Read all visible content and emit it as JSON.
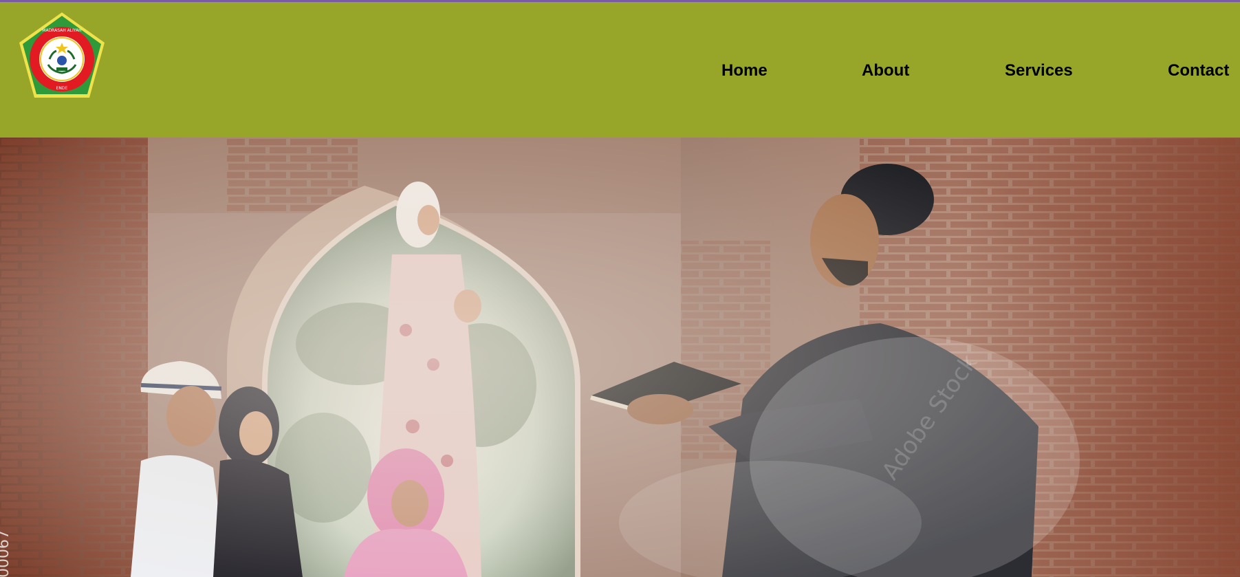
{
  "header": {
    "logo": {
      "name": "school-emblem",
      "ring_text": "MADRASAH ALIYAH KEJURUAN NEGERI",
      "bottom_text": "ENDE",
      "colors": {
        "outer": "#2f9a3a",
        "ring": "#e21b23",
        "inner": "#ffffff",
        "accent": "#f0c419"
      }
    },
    "background_color": "#97a629",
    "border_color": "#7a5aa6"
  },
  "nav": {
    "items": [
      {
        "label": "Home"
      },
      {
        "label": "About"
      },
      {
        "label": "Services"
      },
      {
        "label": "Contact"
      }
    ]
  },
  "hero": {
    "image": "photo-teacher-reading-to-children-in-ruin",
    "watermark": "Adobe Stock",
    "side_text": "00067"
  }
}
